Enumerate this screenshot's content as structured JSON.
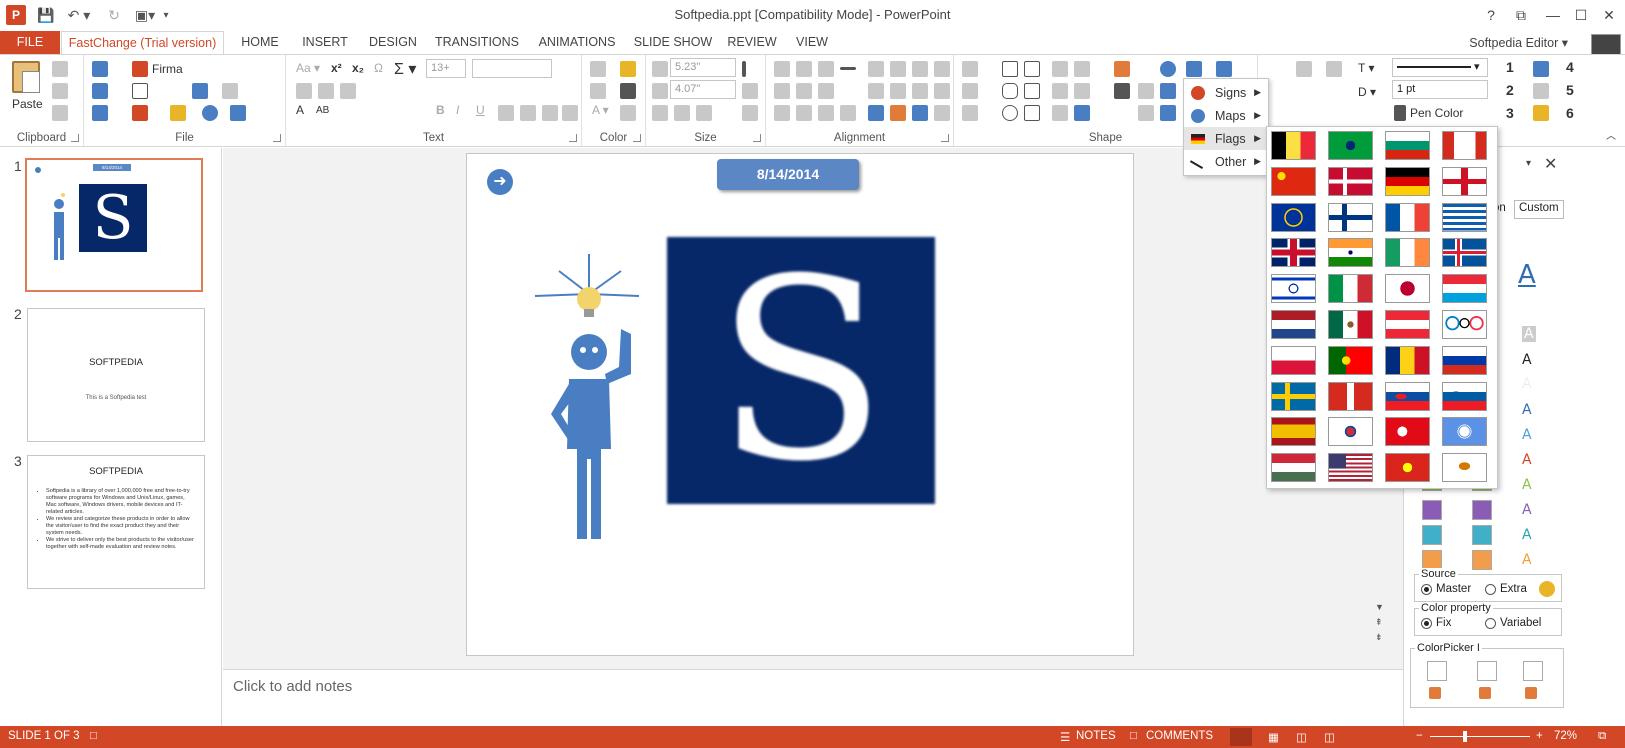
{
  "window": {
    "title": "Softpedia.ppt [Compatibility Mode] - PowerPoint",
    "controls": [
      "?",
      "⧉",
      "—",
      "☐",
      "✕"
    ]
  },
  "tabs": [
    {
      "label": "FILE"
    },
    {
      "label": "FastChange (Trial version)"
    },
    {
      "label": "HOME"
    },
    {
      "label": "INSERT"
    },
    {
      "label": "DESIGN"
    },
    {
      "label": "TRANSITIONS"
    },
    {
      "label": "ANIMATIONS"
    },
    {
      "label": "SLIDE SHOW"
    },
    {
      "label": "REVIEW"
    },
    {
      "label": "VIEW"
    }
  ],
  "user": {
    "name": "Softpedia Editor ▾"
  },
  "ribbon": {
    "groups": [
      {
        "label": "Clipboard"
      },
      {
        "label": "File"
      },
      {
        "label": "Text"
      },
      {
        "label": "Color"
      },
      {
        "label": "Size"
      },
      {
        "label": "Alignment"
      },
      {
        "label": "Shape"
      }
    ],
    "paste_label": "Paste",
    "firma_label": "Firma",
    "font_size": "13+",
    "width_value": "5.23\"",
    "height_value": "4.07\"",
    "line_weight": "1 pt",
    "pen_color_label": "Pen Color",
    "numbers": [
      "1",
      "2",
      "3",
      "4",
      "5",
      "6"
    ]
  },
  "menu": {
    "items": [
      {
        "label": "Signs"
      },
      {
        "label": "Maps"
      },
      {
        "label": "Flags"
      },
      {
        "label": "Other"
      }
    ]
  },
  "flags": [
    "belgium",
    "brazil",
    "bulgaria",
    "canada",
    "china",
    "denmark",
    "germany",
    "england",
    "european-union",
    "finland",
    "france",
    "greece",
    "united-kingdom",
    "india",
    "ireland",
    "iceland",
    "israel",
    "italy",
    "japan",
    "luxembourg",
    "netherlands",
    "mexico",
    "austria",
    "olympics",
    "poland",
    "portugal",
    "romania",
    "russia",
    "sweden",
    "switzerland",
    "slovakia",
    "slovenia",
    "spain",
    "south-korea",
    "turkey",
    "united-nations",
    "hungary",
    "usa",
    "vietnam",
    "cyprus"
  ],
  "slides": [
    {
      "num": "1",
      "date": "8/14/2014"
    },
    {
      "num": "2",
      "title": "SOFTPEDIA",
      "subtitle": "This is a Softpedia test"
    },
    {
      "num": "3",
      "title": "SOFTPEDIA",
      "bullets": [
        "Softpedia is a library of over 1,000,000 free and free-to-try software programs for Windows and Unix/Linux, games, Mac software, Windows drivers, mobile devices and IT-related articles.",
        "We review and categorize these products in order to allow the visitor/user to find the exact product they and their system needs.",
        "We strive to deliver only the best products to the visitor/user together with self-made evaluation and review notes."
      ]
    }
  ],
  "current_slide": {
    "date": "8/14/2014",
    "logo_letter": "S"
  },
  "notes": {
    "placeholder": "Click to add notes"
  },
  "taskpane": {
    "tabs": [
      "on",
      "Custom"
    ],
    "source": {
      "legend": "Source",
      "options": [
        "Master",
        "Extra"
      ],
      "selected": "Master"
    },
    "color_property": {
      "legend": "Color property",
      "options": [
        "Fix",
        "Variabel"
      ],
      "selected": "Fix"
    },
    "colorpicker": {
      "legend": "ColorPicker I"
    }
  },
  "status": {
    "slide": "SLIDE 1 OF 3",
    "notes": "NOTES",
    "comments": "COMMENTS",
    "zoom": "72%"
  },
  "colors": {
    "accent": "#d24726",
    "slide_blue": "#5b87c5",
    "logo_navy": "#062768"
  }
}
